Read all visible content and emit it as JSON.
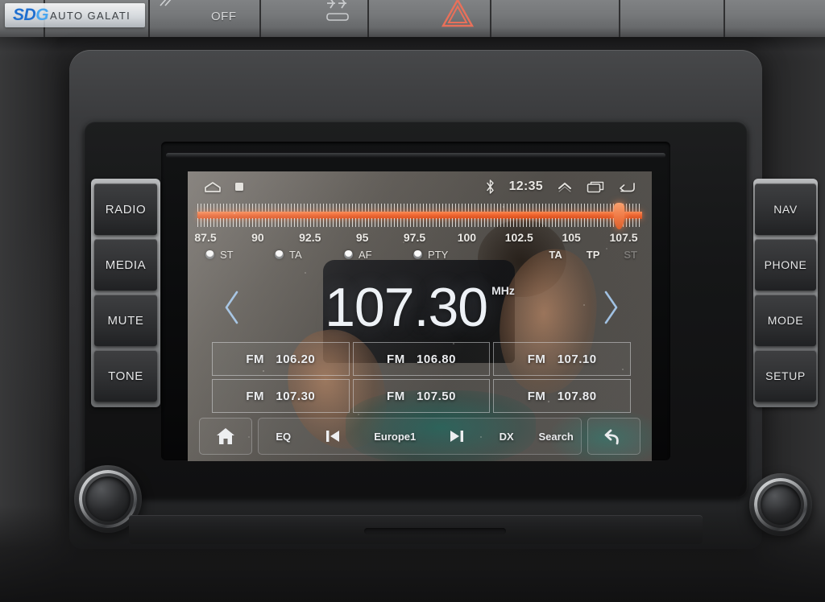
{
  "watermark": {
    "brand_primary": "SD",
    "brand_accent": "G",
    "subtitle": "AUTO GALATI",
    "color_primary": "#1f6fd0",
    "color_accent": "#49a6f0"
  },
  "dashboard": {
    "climate_strip": {
      "off_label": "OFF",
      "rear_defrost_icon": "rear-defrost-icon",
      "hazard_icon": "hazard-triangle-icon",
      "hazard_color": "#e8705a"
    }
  },
  "head_unit": {
    "left_buttons": [
      {
        "label": "RADIO",
        "name": "radio-button"
      },
      {
        "label": "MEDIA",
        "name": "media-button"
      },
      {
        "label": "MUTE",
        "name": "mute-button"
      },
      {
        "label": "TONE",
        "name": "tone-button"
      }
    ],
    "right_buttons": [
      {
        "label": "NAV",
        "name": "nav-button"
      },
      {
        "label": "PHONE",
        "name": "phone-button"
      },
      {
        "label": "MODE",
        "name": "mode-button"
      },
      {
        "label": "SETUP",
        "name": "setup-button"
      }
    ],
    "left_knob_name": "volume-power-knob",
    "right_knob_name": "tune-scroll-knob"
  },
  "screen": {
    "statusbar": {
      "home_icon": "home-outline-icon",
      "stop_icon": "square-icon",
      "bluetooth_icon": "bluetooth-icon",
      "time": "12:35",
      "chevron_up_icon": "chevron-up-icon",
      "recents_icon": "recents-icon",
      "back_icon": "back-arrow-icon"
    },
    "band_scale": {
      "unit": "MHz",
      "min": 87.5,
      "max": 108.0,
      "labels": [
        "87.5",
        "90",
        "92.5",
        "95",
        "97.5",
        "100",
        "102.5",
        "105",
        "107.5"
      ],
      "label_values": [
        87.5,
        90,
        92.5,
        95,
        97.5,
        100,
        102.5,
        105,
        107.5
      ],
      "marker_value": 107.3,
      "bar_color": "#f4622a",
      "marker_color": "#f4743c"
    },
    "rds_left": [
      {
        "label": "ST",
        "name": "rds-st-toggle"
      },
      {
        "label": "TA",
        "name": "rds-ta-toggle"
      },
      {
        "label": "AF",
        "name": "rds-af-toggle"
      },
      {
        "label": "PTY",
        "name": "rds-pty-toggle"
      }
    ],
    "rds_right": [
      {
        "label": "TA",
        "active": true,
        "name": "rds-ta-indicator"
      },
      {
        "label": "TP",
        "active": true,
        "name": "rds-tp-indicator"
      },
      {
        "label": "ST",
        "active": false,
        "name": "rds-st-indicator"
      }
    ],
    "tuner": {
      "prev_icon": "chevron-left-icon",
      "next_icon": "chevron-right-icon",
      "frequency": "107.30",
      "unit": "MHz"
    },
    "presets": [
      {
        "band": "FM",
        "freq": "106.20",
        "name": "preset-1"
      },
      {
        "band": "FM",
        "freq": "106.80",
        "name": "preset-2"
      },
      {
        "band": "FM",
        "freq": "107.10",
        "name": "preset-3"
      },
      {
        "band": "FM",
        "freq": "107.30",
        "name": "preset-4"
      },
      {
        "band": "FM",
        "freq": "107.50",
        "name": "preset-5"
      },
      {
        "band": "FM",
        "freq": "107.80",
        "name": "preset-6"
      }
    ],
    "toolbar": {
      "home_icon": "home-filled-icon",
      "eq_label": "EQ",
      "prev_icon": "skip-previous-icon",
      "station_label": "Europe1",
      "next_icon": "skip-next-icon",
      "dx_label": "DX",
      "search_label": "Search",
      "back_icon": "back-curved-arrow-icon"
    }
  }
}
